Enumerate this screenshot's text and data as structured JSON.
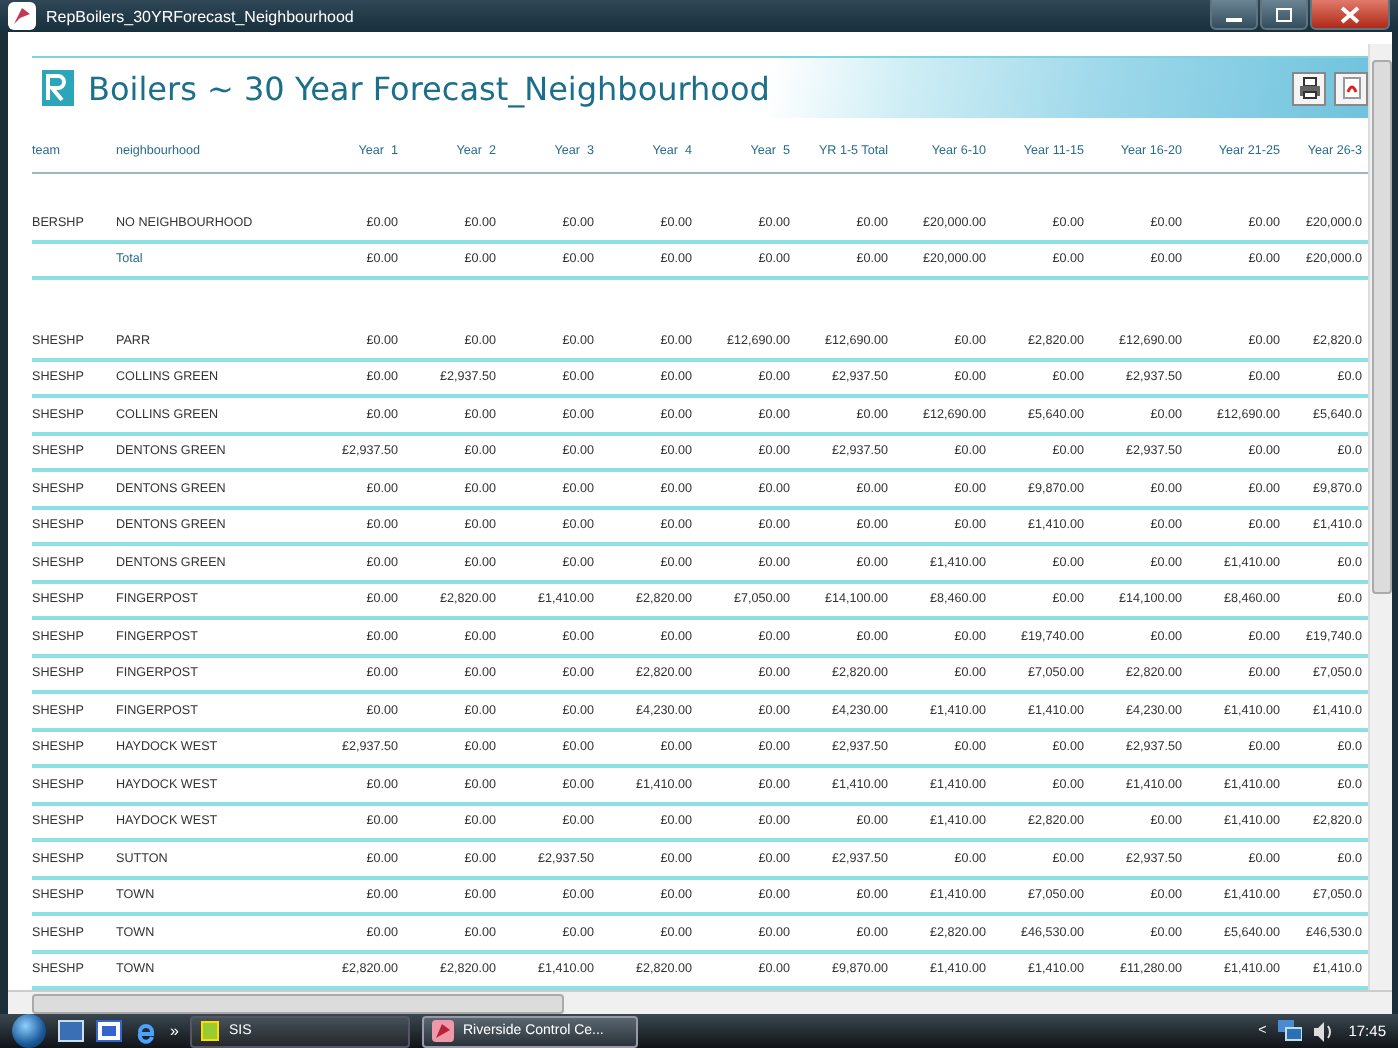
{
  "window": {
    "title": "RepBoilers_30YRForecast_Neighbourhood"
  },
  "report": {
    "title": "Boilers ~ 30 Year Forecast_Neighbourhood",
    "columns": [
      "team",
      "neighbourhood",
      "Year  1",
      "Year  2",
      "Year  3",
      "Year  4",
      "Year  5",
      "YR 1-5 Total",
      "Year 6-10",
      "Year 11-15",
      "Year 16-20",
      "Year 21-25",
      "Year 26-3"
    ],
    "groups": [
      {
        "rows": [
          {
            "team": "BERSHP",
            "neighbourhood": "NO NEIGHBOURHOOD",
            "values": [
              "£0.00",
              "£0.00",
              "£0.00",
              "£0.00",
              "£0.00",
              "£0.00",
              "£20,000.00",
              "£0.00",
              "£0.00",
              "£0.00",
              "£20,000.0"
            ]
          }
        ],
        "total": {
          "label": "Total",
          "values": [
            "£0.00",
            "£0.00",
            "£0.00",
            "£0.00",
            "£0.00",
            "£0.00",
            "£20,000.00",
            "£0.00",
            "£0.00",
            "£0.00",
            "£20,000.0"
          ]
        }
      },
      {
        "rows": [
          {
            "team": "SHESHP",
            "neighbourhood": "PARR",
            "values": [
              "£0.00",
              "£0.00",
              "£0.00",
              "£0.00",
              "£12,690.00",
              "£12,690.00",
              "£0.00",
              "£2,820.00",
              "£12,690.00",
              "£0.00",
              "£2,820.0"
            ]
          },
          {
            "team": "SHESHP",
            "neighbourhood": "COLLINS GREEN",
            "values": [
              "£0.00",
              "£2,937.50",
              "£0.00",
              "£0.00",
              "£0.00",
              "£2,937.50",
              "£0.00",
              "£0.00",
              "£2,937.50",
              "£0.00",
              "£0.0"
            ]
          },
          {
            "team": "SHESHP",
            "neighbourhood": "COLLINS GREEN",
            "values": [
              "£0.00",
              "£0.00",
              "£0.00",
              "£0.00",
              "£0.00",
              "£0.00",
              "£12,690.00",
              "£5,640.00",
              "£0.00",
              "£12,690.00",
              "£5,640.0"
            ]
          },
          {
            "team": "SHESHP",
            "neighbourhood": "DENTONS GREEN",
            "values": [
              "£2,937.50",
              "£0.00",
              "£0.00",
              "£0.00",
              "£0.00",
              "£2,937.50",
              "£0.00",
              "£0.00",
              "£2,937.50",
              "£0.00",
              "£0.0"
            ]
          },
          {
            "team": "SHESHP",
            "neighbourhood": "DENTONS GREEN",
            "values": [
              "£0.00",
              "£0.00",
              "£0.00",
              "£0.00",
              "£0.00",
              "£0.00",
              "£0.00",
              "£9,870.00",
              "£0.00",
              "£0.00",
              "£9,870.0"
            ]
          },
          {
            "team": "SHESHP",
            "neighbourhood": "DENTONS GREEN",
            "values": [
              "£0.00",
              "£0.00",
              "£0.00",
              "£0.00",
              "£0.00",
              "£0.00",
              "£0.00",
              "£1,410.00",
              "£0.00",
              "£0.00",
              "£1,410.0"
            ]
          },
          {
            "team": "SHESHP",
            "neighbourhood": "DENTONS GREEN",
            "values": [
              "£0.00",
              "£0.00",
              "£0.00",
              "£0.00",
              "£0.00",
              "£0.00",
              "£1,410.00",
              "£0.00",
              "£0.00",
              "£1,410.00",
              "£0.0"
            ]
          },
          {
            "team": "SHESHP",
            "neighbourhood": "FINGERPOST",
            "values": [
              "£0.00",
              "£2,820.00",
              "£1,410.00",
              "£2,820.00",
              "£7,050.00",
              "£14,100.00",
              "£8,460.00",
              "£0.00",
              "£14,100.00",
              "£8,460.00",
              "£0.0"
            ]
          },
          {
            "team": "SHESHP",
            "neighbourhood": "FINGERPOST",
            "values": [
              "£0.00",
              "£0.00",
              "£0.00",
              "£0.00",
              "£0.00",
              "£0.00",
              "£0.00",
              "£19,740.00",
              "£0.00",
              "£0.00",
              "£19,740.0"
            ]
          },
          {
            "team": "SHESHP",
            "neighbourhood": "FINGERPOST",
            "values": [
              "£0.00",
              "£0.00",
              "£0.00",
              "£2,820.00",
              "£0.00",
              "£2,820.00",
              "£0.00",
              "£7,050.00",
              "£2,820.00",
              "£0.00",
              "£7,050.0"
            ]
          },
          {
            "team": "SHESHP",
            "neighbourhood": "FINGERPOST",
            "values": [
              "£0.00",
              "£0.00",
              "£0.00",
              "£4,230.00",
              "£0.00",
              "£4,230.00",
              "£1,410.00",
              "£1,410.00",
              "£4,230.00",
              "£1,410.00",
              "£1,410.0"
            ]
          },
          {
            "team": "SHESHP",
            "neighbourhood": "HAYDOCK WEST",
            "values": [
              "£2,937.50",
              "£0.00",
              "£0.00",
              "£0.00",
              "£0.00",
              "£2,937.50",
              "£0.00",
              "£0.00",
              "£2,937.50",
              "£0.00",
              "£0.0"
            ]
          },
          {
            "team": "SHESHP",
            "neighbourhood": "HAYDOCK WEST",
            "values": [
              "£0.00",
              "£0.00",
              "£0.00",
              "£1,410.00",
              "£0.00",
              "£1,410.00",
              "£1,410.00",
              "£0.00",
              "£1,410.00",
              "£1,410.00",
              "£0.0"
            ]
          },
          {
            "team": "SHESHP",
            "neighbourhood": "HAYDOCK WEST",
            "values": [
              "£0.00",
              "£0.00",
              "£0.00",
              "£0.00",
              "£0.00",
              "£0.00",
              "£1,410.00",
              "£2,820.00",
              "£0.00",
              "£1,410.00",
              "£2,820.0"
            ]
          },
          {
            "team": "SHESHP",
            "neighbourhood": "SUTTON",
            "values": [
              "£0.00",
              "£0.00",
              "£2,937.50",
              "£0.00",
              "£0.00",
              "£2,937.50",
              "£0.00",
              "£0.00",
              "£2,937.50",
              "£0.00",
              "£0.0"
            ]
          },
          {
            "team": "SHESHP",
            "neighbourhood": "TOWN",
            "values": [
              "£0.00",
              "£0.00",
              "£0.00",
              "£0.00",
              "£0.00",
              "£0.00",
              "£1,410.00",
              "£7,050.00",
              "£0.00",
              "£1,410.00",
              "£7,050.0"
            ]
          },
          {
            "team": "SHESHP",
            "neighbourhood": "TOWN",
            "values": [
              "£0.00",
              "£0.00",
              "£0.00",
              "£0.00",
              "£0.00",
              "£0.00",
              "£2,820.00",
              "£46,530.00",
              "£0.00",
              "£5,640.00",
              "£46,530.0"
            ]
          },
          {
            "team": "SHESHP",
            "neighbourhood": "TOWN",
            "values": [
              "£2,820.00",
              "£2,820.00",
              "£1,410.00",
              "£2,820.00",
              "£0.00",
              "£9,870.00",
              "£1,410.00",
              "£1,410.00",
              "£11,280.00",
              "£1,410.00",
              "£1,410.0"
            ]
          }
        ]
      }
    ]
  },
  "taskbar": {
    "more": "»",
    "buttons": [
      {
        "label": "SIS",
        "selected": false
      },
      {
        "label": "Riverside Control Ce...",
        "selected": true
      }
    ],
    "tray_expand": "<",
    "clock": "17:45"
  }
}
